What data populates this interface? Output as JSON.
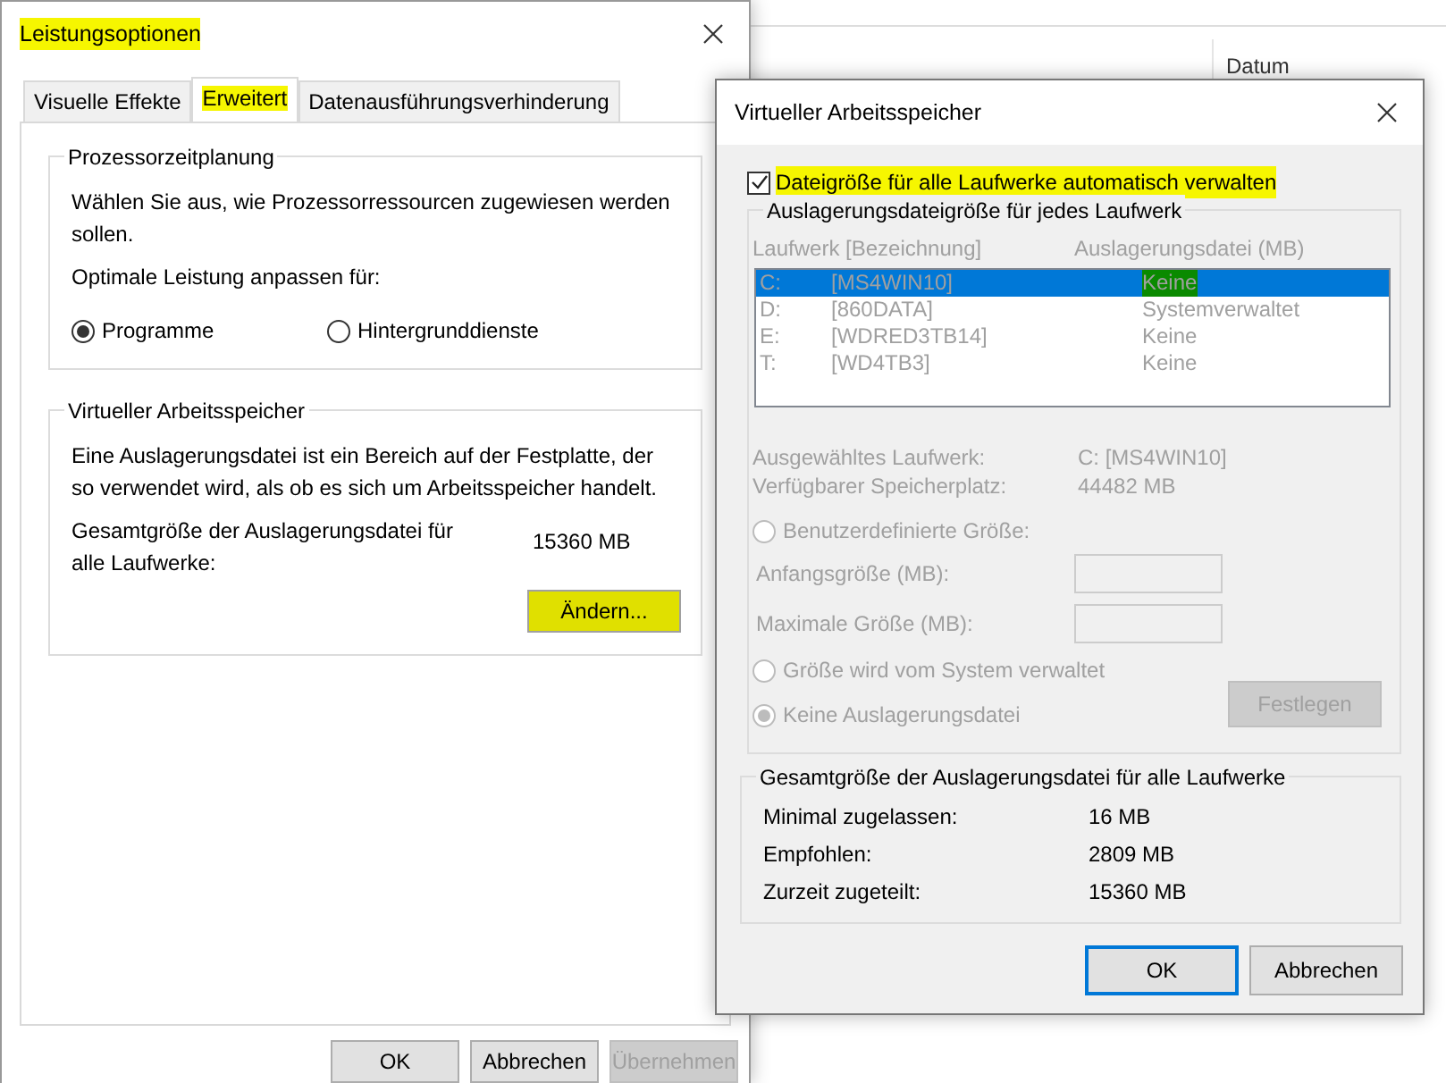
{
  "background_window": {
    "column_header": "Datum"
  },
  "performance_dialog": {
    "title": "Leistungsoptionen",
    "title_highlighted": true,
    "tabs": [
      {
        "label": "Visuelle Effekte",
        "selected": false,
        "highlighted": false
      },
      {
        "label": "Erweitert",
        "selected": true,
        "highlighted": true
      },
      {
        "label": "Datenausführungsverhinderung",
        "selected": false,
        "highlighted": false
      }
    ],
    "processor_group": {
      "title": "Prozessorzeitplanung",
      "description": "Wählen Sie aus, wie Prozessorressourcen zugewiesen werden sollen.",
      "prompt": "Optimale Leistung anpassen für:",
      "options": [
        {
          "label": "Programme",
          "selected": true
        },
        {
          "label": "Hintergrunddienste",
          "selected": false
        }
      ]
    },
    "virtual_memory_group": {
      "title": "Virtueller Arbeitsspeicher",
      "description": "Eine Auslagerungsdatei ist ein Bereich auf der Festplatte, der so verwendet wird, als ob es sich um Arbeitsspeicher handelt.",
      "total_label": "Gesamtgröße der Auslagerungsdatei für alle Laufwerke:",
      "total_value": "15360 MB",
      "change_button": {
        "label": "Ändern...",
        "highlighted": true
      }
    },
    "buttons": [
      {
        "label": "OK",
        "disabled": false
      },
      {
        "label": "Abbrechen",
        "disabled": false
      },
      {
        "label": "Übernehmen",
        "disabled": true
      }
    ]
  },
  "virtual_memory_dialog": {
    "title": "Virtueller Arbeitsspeicher",
    "auto_manage": {
      "label": "Dateigröße für alle Laufwerke automatisch verwalten",
      "checked": true,
      "highlighted": true
    },
    "drive_group": {
      "title": "Auslagerungsdateigröße für jedes Laufwerk",
      "disabled": true,
      "columns": [
        "Laufwerk [Bezeichnung]",
        "Auslagerungsdatei (MB)"
      ],
      "drives": [
        {
          "letter": "C:",
          "volume": "[MS4WIN10]",
          "paging_file": "Keine",
          "selected": true,
          "highlighted": true
        },
        {
          "letter": "D:",
          "volume": "[860DATA]",
          "paging_file": "Systemverwaltet",
          "selected": false,
          "highlighted": false
        },
        {
          "letter": "E:",
          "volume": "[WDRED3TB14]",
          "paging_file": "Keine",
          "selected": false,
          "highlighted": false
        },
        {
          "letter": "T:",
          "volume": "[WD4TB3]",
          "paging_file": "Keine",
          "selected": false,
          "highlighted": false
        }
      ],
      "info": [
        {
          "label": "Ausgewähltes Laufwerk:",
          "value": "C:  [MS4WIN10]"
        },
        {
          "label": "Verfügbarer Speicherplatz:",
          "value": "44482 MB"
        }
      ],
      "size_options": [
        {
          "kind": "radio",
          "label": "Benutzerdefinierte Größe:",
          "selected": false
        },
        {
          "kind": "field",
          "label": "Anfangsgröße (MB):"
        },
        {
          "kind": "field",
          "label": "Maximale Größe (MB):"
        },
        {
          "kind": "radio",
          "label": "Größe wird vom System verwaltet",
          "selected": false
        },
        {
          "kind": "radio",
          "label": "Keine Auslagerungsdatei",
          "selected": true
        }
      ],
      "set_button": {
        "label": "Festlegen"
      }
    },
    "total_group": {
      "title": "Gesamtgröße der Auslagerungsdatei für alle Laufwerke",
      "rows": [
        {
          "label": "Minimal zugelassen:",
          "value": "16 MB"
        },
        {
          "label": "Empfohlen:",
          "value": "2809 MB"
        },
        {
          "label": "Zurzeit zugeteilt:",
          "value": "15360 MB"
        }
      ]
    },
    "buttons": [
      {
        "label": "OK",
        "focused": true
      },
      {
        "label": "Abbrechen",
        "focused": false
      }
    ]
  }
}
